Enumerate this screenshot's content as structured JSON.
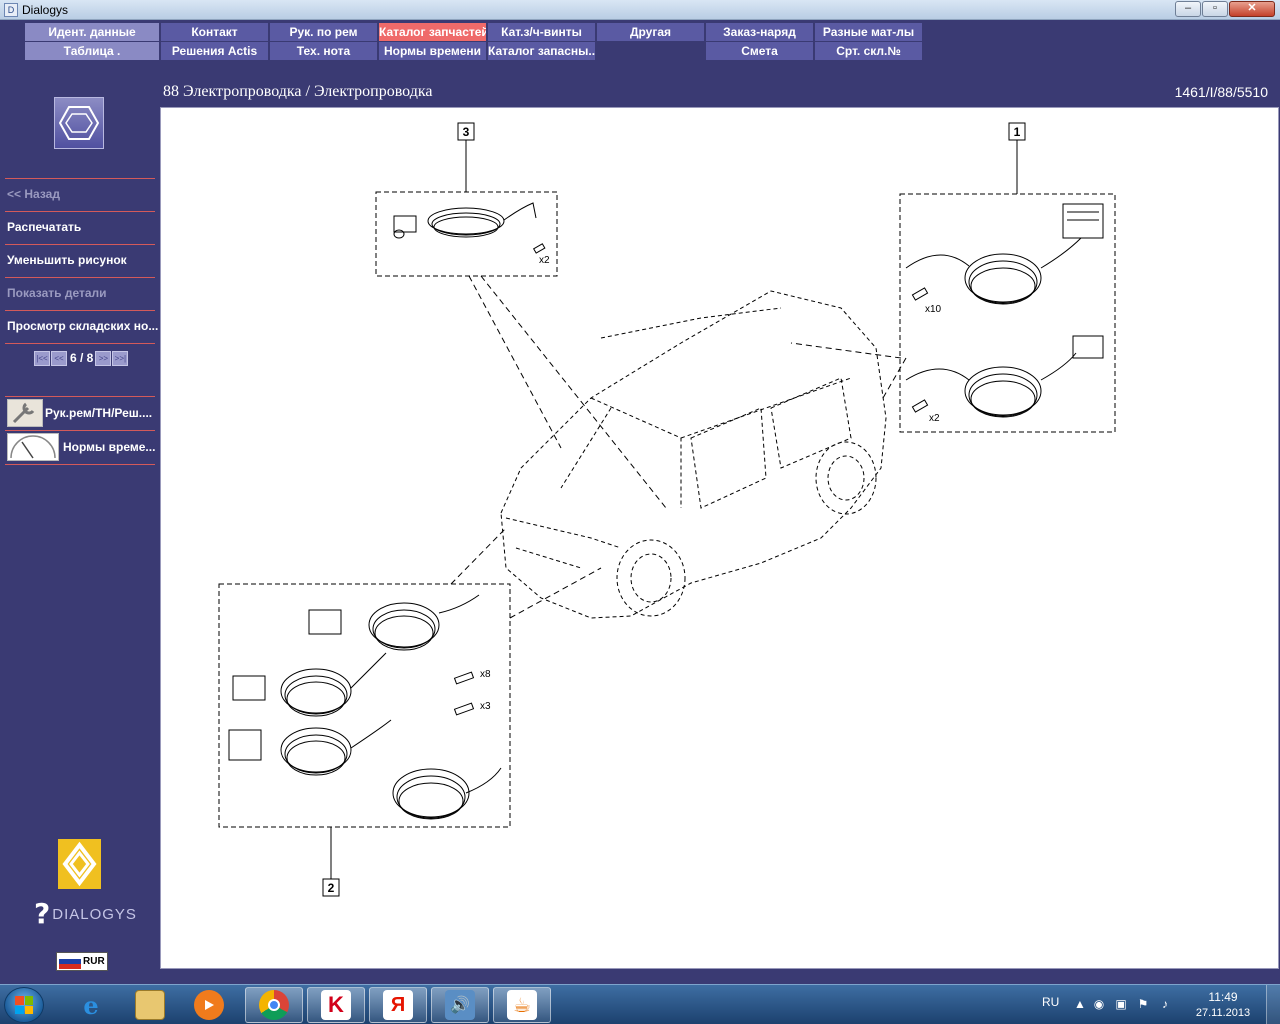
{
  "window": {
    "title": "Dialogys",
    "app_icon": "D",
    "controls": {
      "min": "–",
      "max": "▫",
      "close": "✕"
    }
  },
  "menu": {
    "row1": [
      "Идент. данные",
      "Контакт",
      "Рук. по рем",
      "Каталог запчастей",
      "Кат.з/ч-винты",
      "Другая",
      "Заказ-наряд",
      "Разные мат-лы"
    ],
    "row2": [
      "Таблица .",
      "Решения Actis",
      "Тех. нота",
      "Нормы времени",
      "Каталог запасны...",
      "Смета",
      "Срт. скл.№"
    ]
  },
  "sidebar": {
    "back": "<< Назад",
    "items": [
      "Распечатать",
      "Уменьшить рисунок",
      "Показать детали",
      "Просмотр складских но..."
    ],
    "pager": {
      "current": "6",
      "total": "8",
      "text": "6 / 8",
      "first": "|<<",
      "prev": "<<",
      "next": ">>",
      "last": ">>|"
    },
    "tools": [
      {
        "label": "Рук.рем/ТН/Реш....",
        "icon": "wrench-icon"
      },
      {
        "label": "Нормы време...",
        "icon": "speedometer-icon"
      }
    ],
    "brand": {
      "symbol": "?",
      "name": "DIALOGYS"
    },
    "language": {
      "code": "RUR"
    }
  },
  "content": {
    "title": "88 Электропроводка / Электропроводка",
    "reference": "1461/I/88/5510"
  },
  "diagram": {
    "callouts": [
      "3",
      "1",
      "2"
    ],
    "qty_labels": [
      "x2",
      "x10",
      "x2",
      "x8",
      "x3"
    ]
  },
  "taskbar": {
    "apps": [
      "internet-explorer-icon",
      "file-explorer-icon",
      "media-player-icon",
      "chrome-icon",
      "kaspersky-icon",
      "yandex-icon",
      "audio-icon",
      "java-icon"
    ],
    "app_glyphs": {
      "ie": "e",
      "yandex": "Я",
      "kaspersky": "K",
      "java": "☕",
      "audio": "🔊"
    },
    "tray": {
      "lang": "RU",
      "time": "11:49",
      "date": "27.11.2013"
    }
  },
  "colors": {
    "background": "#3a3a73",
    "menu_light": "#8a8ac4",
    "menu_mid": "#5a5aa3",
    "menu_active": "#ef6a6a",
    "separator": "#d45a5a"
  }
}
